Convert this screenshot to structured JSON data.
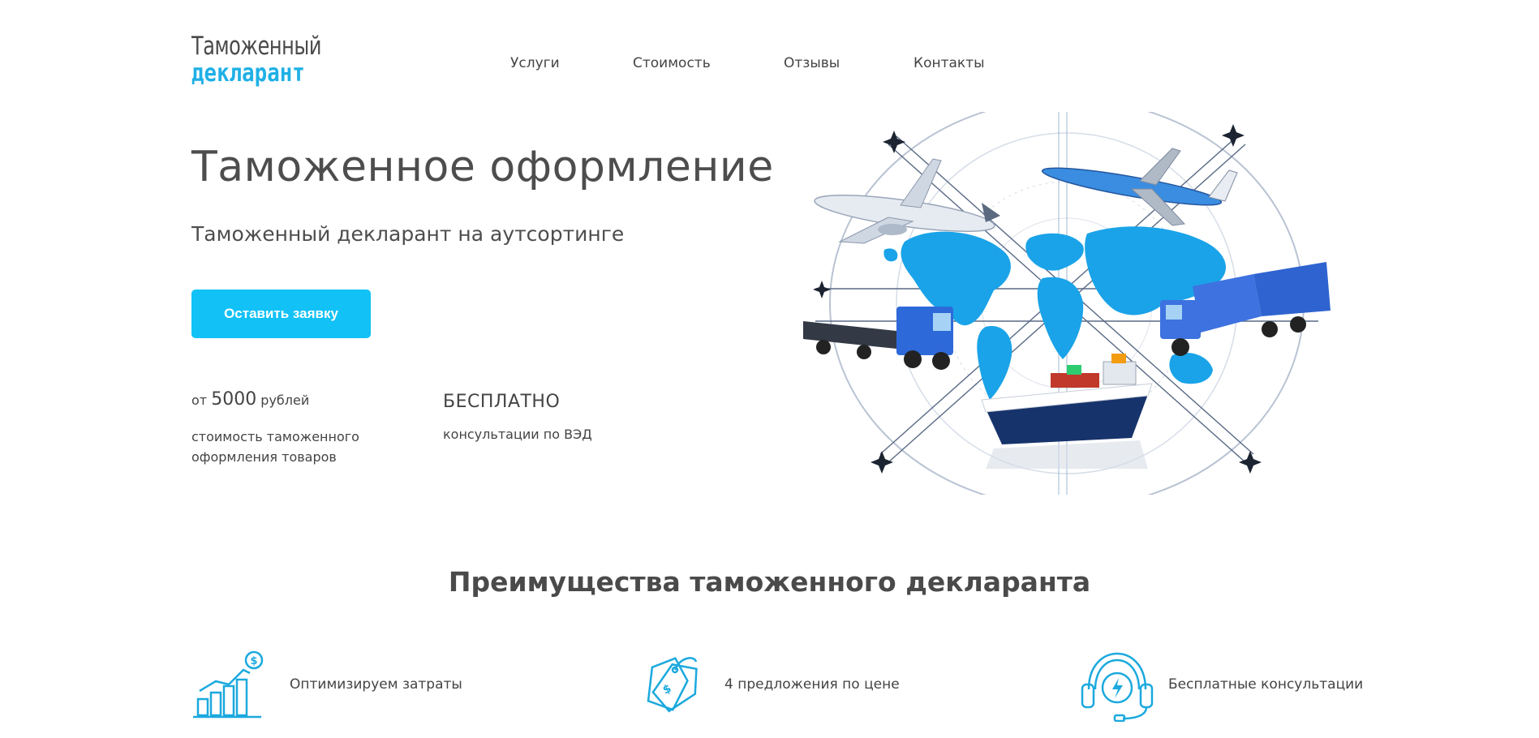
{
  "logo": {
    "line1": "Таможенный",
    "line2": "декларант"
  },
  "nav": {
    "items": [
      {
        "label": "Услуги"
      },
      {
        "label": "Стоимость"
      },
      {
        "label": "Отзывы"
      },
      {
        "label": "Контакты"
      }
    ]
  },
  "hero": {
    "title": "Таможенное оформление",
    "subtitle": "Таможенный декларант на аутсортинге",
    "cta_label": "Оставить заявку",
    "stats": {
      "price_prefix": "от",
      "price_value": "5000",
      "price_suffix": "рублей",
      "price_desc": "стоимость таможенного оформления товаров",
      "free_title": "БЕСПЛАТНО",
      "free_desc": "консультации по ВЭД"
    }
  },
  "benefits": {
    "title": "Преимущества таможенного декларанта",
    "items": [
      {
        "label": "Оптимизируем затраты",
        "icon": "chart-dollar-icon"
      },
      {
        "label": "4 предложения по цене",
        "icon": "price-tags-icon"
      },
      {
        "label": "Бесплатные консультации",
        "icon": "headset-icon"
      }
    ]
  },
  "colors": {
    "accent": "#12c1f6",
    "text": "#444444",
    "logo_accent": "#1fb0e6"
  }
}
